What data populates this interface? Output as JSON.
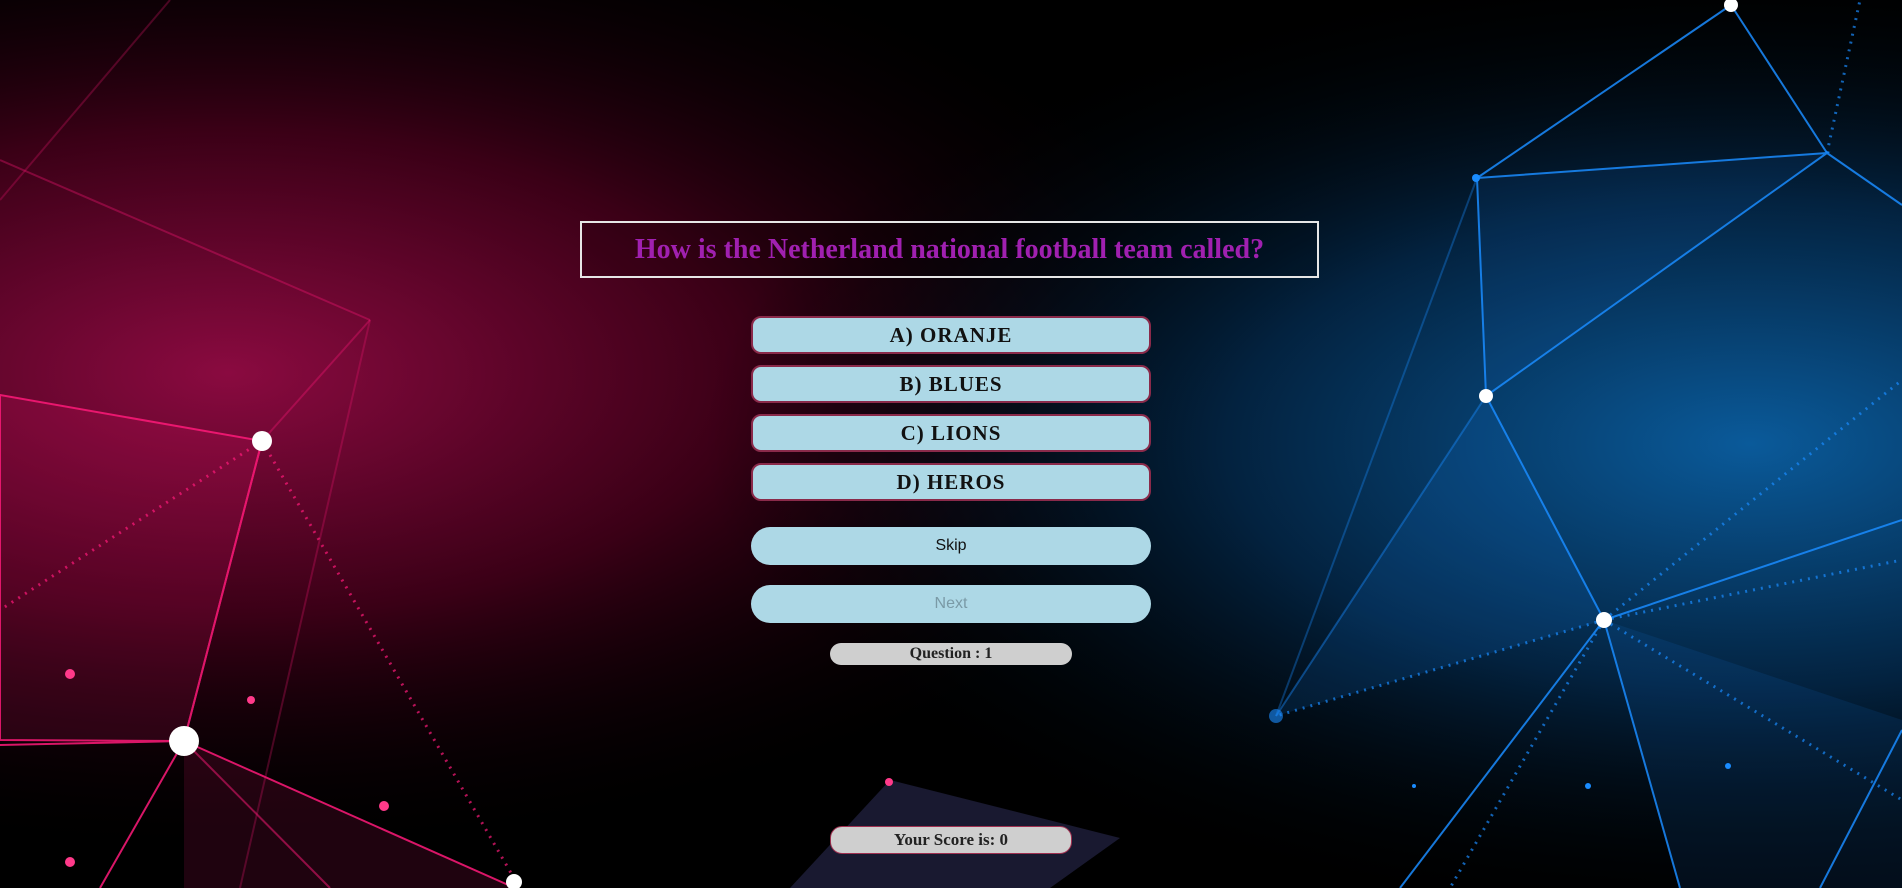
{
  "quiz": {
    "question": "How is the Netherland national football team called?",
    "answers": [
      "A) ORANJE",
      "B) BLUES",
      "C) LIONS",
      "D) HEROS"
    ],
    "skip_label": "Skip",
    "next_label": "Next",
    "question_counter": "Question : 1",
    "score_text": "Your Score is: 0"
  },
  "colors": {
    "question_text": "#a020b0",
    "button_bg": "#add8e6",
    "left_glow": "#ff1a7a",
    "right_glow": "#1a8cff"
  }
}
